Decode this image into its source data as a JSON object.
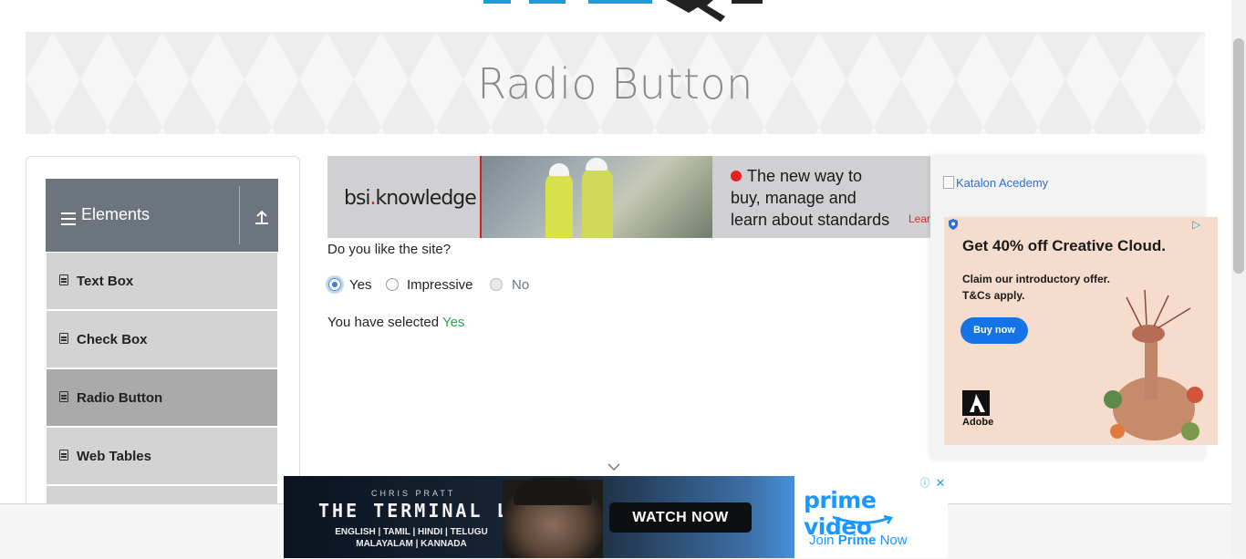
{
  "banner": {
    "title": "Radio Button"
  },
  "sidebar": {
    "group": {
      "label": "Elements"
    },
    "items": [
      {
        "label": "Text Box"
      },
      {
        "label": "Check Box"
      },
      {
        "label": "Radio Button",
        "active": true
      },
      {
        "label": "Web Tables"
      }
    ]
  },
  "ad_top": {
    "logo_main": "bsi",
    "logo_rest": "knowledge",
    "line1": "The new way to",
    "line2": "buy, manage and",
    "line3": "learn about standards",
    "learn": "Learn"
  },
  "question": {
    "label": "Do you like the site?",
    "options": [
      {
        "label": "Yes",
        "checked": true
      },
      {
        "label": "Impressive",
        "checked": false
      },
      {
        "label": "No",
        "disabled": true
      }
    ],
    "result_prefix": "You have selected",
    "result_value": "Yes"
  },
  "right_ad": {
    "katalon_alt": "Katalon Acedemy",
    "adobe": {
      "title": "Get 40% off Creative Cloud.",
      "sub1": "Claim our introductory offer.",
      "sub2": "T&Cs apply.",
      "button": "Buy now",
      "brand": "Adobe"
    }
  },
  "bottom_ad": {
    "actor": "CHRIS PRATT",
    "show": "THE TERMINAL LIST",
    "langs1": "ENGLISH | TAMIL | HINDI | TELUGU",
    "langs2": "MALAYALAM | KANNADA",
    "cta": "WATCH NOW",
    "brand": "prime video",
    "join_prefix": "Join",
    "join_bold": "Prime",
    "join_suffix": "Now"
  },
  "colors": {
    "accent_green": "#28a745",
    "sidebar_header": "#6c757d",
    "sidebar_item": "#d3d3d3",
    "sidebar_active": "#aaaaaa"
  }
}
